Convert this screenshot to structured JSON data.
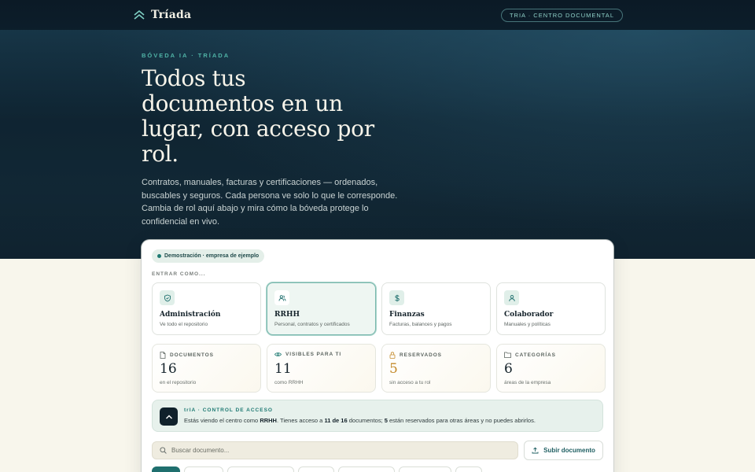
{
  "header": {
    "brand": "Tríada",
    "pill": "trIA · CENTRO DOCUMENTAL"
  },
  "hero": {
    "eyebrow": "BÓVEDA IA · TRÍADA",
    "headline": "Todos tus documentos en un lugar, con acceso por rol.",
    "lead": "Contratos, manuales, facturas y certificaciones — ordenados, buscables y seguros. Cada persona ve solo lo que le corresponde. Cambia de rol aquí abajo y mira cómo la bóveda protege lo confidencial en vivo."
  },
  "demo_chip": "Demostración · empresa de ejemplo",
  "enter_label": "ENTRAR COMO...",
  "roles": [
    {
      "name": "Administración",
      "sub": "Ve todo el repositorio",
      "icon": "shield-icon",
      "active": false
    },
    {
      "name": "RRHH",
      "sub": "Personal, contratos y certificados",
      "icon": "users-icon",
      "active": true
    },
    {
      "name": "Finanzas",
      "sub": "Facturas, balances y pagos",
      "icon": "dollar-icon",
      "active": false
    },
    {
      "name": "Colaborador",
      "sub": "Manuales y políticas",
      "icon": "user-icon",
      "active": false
    }
  ],
  "stats": [
    {
      "label": "DOCUMENTOS",
      "value": "16",
      "sub": "en el repositorio",
      "icon": "file-icon"
    },
    {
      "label": "VISIBLES PARA TI",
      "value": "11",
      "sub": "como RRHH",
      "icon": "eye-icon"
    },
    {
      "label": "RESERVADOS",
      "value": "5",
      "sub": "sin acceso a tu rol",
      "icon": "lock-icon"
    },
    {
      "label": "CATEGORÍAS",
      "value": "6",
      "sub": "áreas de la empresa",
      "icon": "folder-icon"
    }
  ],
  "access": {
    "title": "trIA · CONTROL DE ACCESO",
    "text_1": "Estás viendo el centro como ",
    "role": "RRHH",
    "text_2": ". Tienes acceso a ",
    "visible": "11 de 16",
    "text_3": " documentos; ",
    "reserved": "5",
    "text_4": " están reservados para otras áreas y no puedes abrirlos."
  },
  "search": {
    "placeholder": "Buscar documento..."
  },
  "upload_label": "Subir documento",
  "colors": {
    "accent": "#1f7a73",
    "gold": "#c38a2a",
    "hero_bg": "#0f2533",
    "page_bg": "#f8f6ec"
  }
}
